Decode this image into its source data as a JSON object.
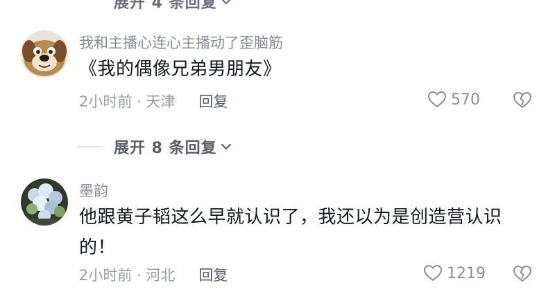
{
  "top_expand": {
    "label": "展开 4 条回复"
  },
  "comments": [
    {
      "username": "我和主播心连心主播动了歪脑筋",
      "text": "《我的偶像兄弟男朋友》",
      "time_location": "2小时前 · 天津",
      "reply_label": "回复",
      "likes": "570",
      "expand_label": "展开 8 条回复"
    },
    {
      "username": "墨韵",
      "text": "他跟黄子韬这么早就认识了，我还以为是创造营认识的！",
      "time_location": "2小时前 · 河北",
      "reply_label": "回复",
      "likes": "1219"
    }
  ],
  "colors": {
    "text": "#161823",
    "meta": "#9a9ca6",
    "username": "#8a8c96"
  }
}
